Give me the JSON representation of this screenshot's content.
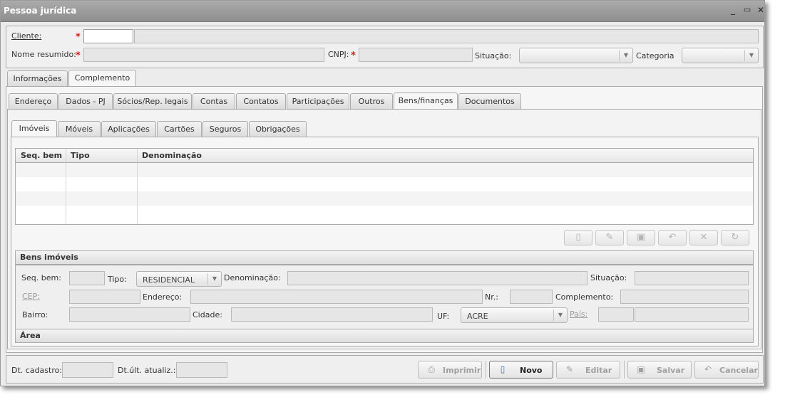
{
  "window": {
    "title": "Pessoa jurídica",
    "controls": [
      "_",
      "▭",
      "✕"
    ]
  },
  "header": {
    "cliente_label": "Cliente:",
    "nome_label": "Nome resumido:",
    "cnpj_label": "CNPJ:",
    "situacao_label": "Situação:",
    "categoria_label": "Categoria",
    "required_mark": "*"
  },
  "outer_tabs": [
    "Informações",
    "Complemento"
  ],
  "sub_tabs": [
    "Endereço",
    "Dados - PJ",
    "Sócios/Rep. legais",
    "Contas",
    "Contatos",
    "Participações",
    "Outros",
    "Bens/finanças",
    "Documentos"
  ],
  "inner_tabs": [
    "Imóveis",
    "Móveis",
    "Aplicações",
    "Cartões",
    "Seguros",
    "Obrigações"
  ],
  "grid": {
    "columns": [
      "Seq. bem",
      "Tipo",
      "Denominação"
    ]
  },
  "toolbar": {
    "icons": [
      "new-doc-icon",
      "edit-icon",
      "save-icon",
      "undo-icon",
      "delete-icon",
      "refresh-icon"
    ]
  },
  "bens": {
    "section_title": "Bens imóveis",
    "seq_label": "Seq. bem:",
    "tipo_label": "Tipo:",
    "tipo_value": "RESIDENCIAL",
    "denominacao_label": "Denominação:",
    "situacao_label": "Situação:",
    "cep_label": "CEP:",
    "endereco_label": "Endereço:",
    "nr_label": "Nr.:",
    "complemento_label": "Complemento:",
    "bairro_label": "Bairro:",
    "cidade_label": "Cidade:",
    "uf_label": "UF:",
    "uf_value": "ACRE",
    "pais_label": "País:",
    "area_title": "Área"
  },
  "footer": {
    "dt_cadastro_label": "Dt. cadastro:",
    "dt_atualiz_label": "Dt.últ. atualiz.:",
    "imprimir": "Imprimir",
    "novo": "Novo",
    "editar": "Editar",
    "salvar": "Salvar",
    "cancelar": "Cancelar"
  }
}
